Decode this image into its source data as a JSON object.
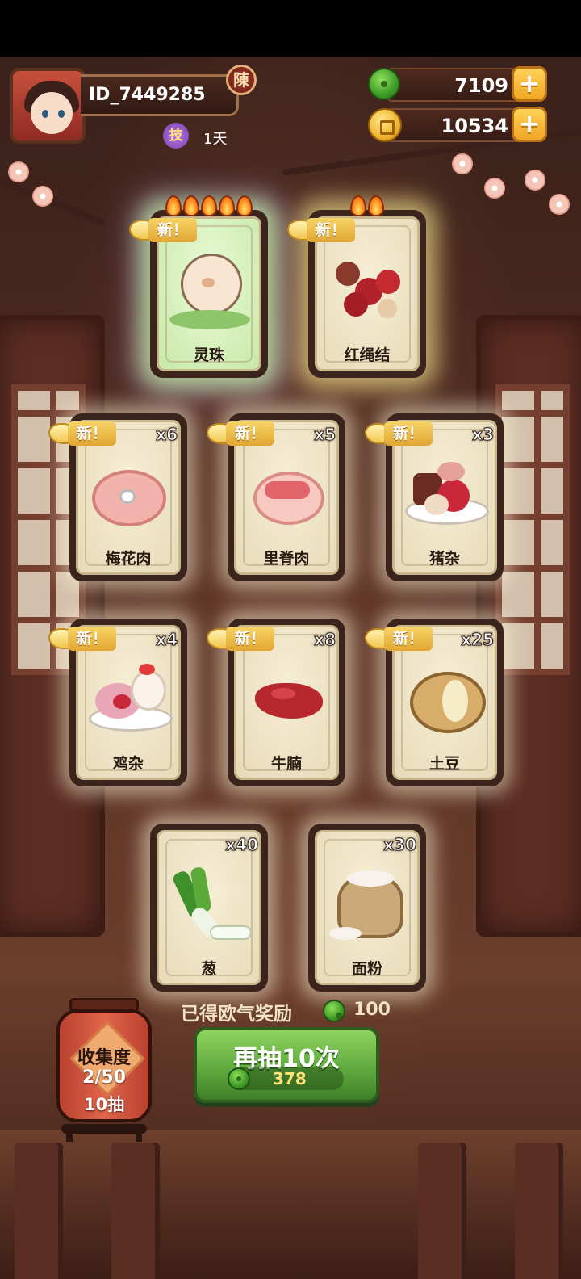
{
  "player": {
    "id": "ID_7449285",
    "badge": "陳",
    "skill_icon": "技",
    "skill_days": "1天"
  },
  "currency": {
    "jade": "7109",
    "gold": "10534",
    "jade_icon": "jade-coin-icon",
    "gold_icon": "gold-coin-icon",
    "plus": "+"
  },
  "new_label": "新！",
  "cards": [
    {
      "name": "灵珠",
      "count": "",
      "is_new": true,
      "flames": 5,
      "rarity": "special"
    },
    {
      "name": "红绳结",
      "count": "",
      "is_new": true,
      "flames": 2,
      "rarity": "gold"
    },
    {
      "name": "梅花肉",
      "count": "x6",
      "is_new": true
    },
    {
      "name": "里脊肉",
      "count": "x5",
      "is_new": true
    },
    {
      "name": "猪杂",
      "count": "x3",
      "is_new": true
    },
    {
      "name": "鸡杂",
      "count": "x4",
      "is_new": true
    },
    {
      "name": "牛腩",
      "count": "x8",
      "is_new": true
    },
    {
      "name": "土豆",
      "count": "x25",
      "is_new": true
    },
    {
      "name": "葱",
      "count": "x40",
      "is_new": false
    },
    {
      "name": "面粉",
      "count": "x30",
      "is_new": false
    }
  ],
  "bonus": {
    "label": "已得欧气奖励",
    "value": "100"
  },
  "redraw": {
    "label": "再抽10次",
    "cost": "378"
  },
  "collection": {
    "title": "收集度",
    "progress": "2/50",
    "draws": "10抽"
  },
  "colors": {
    "accent_green": "#5ca63b",
    "gold": "#f0a625",
    "card_bg": "#f6eed6"
  }
}
